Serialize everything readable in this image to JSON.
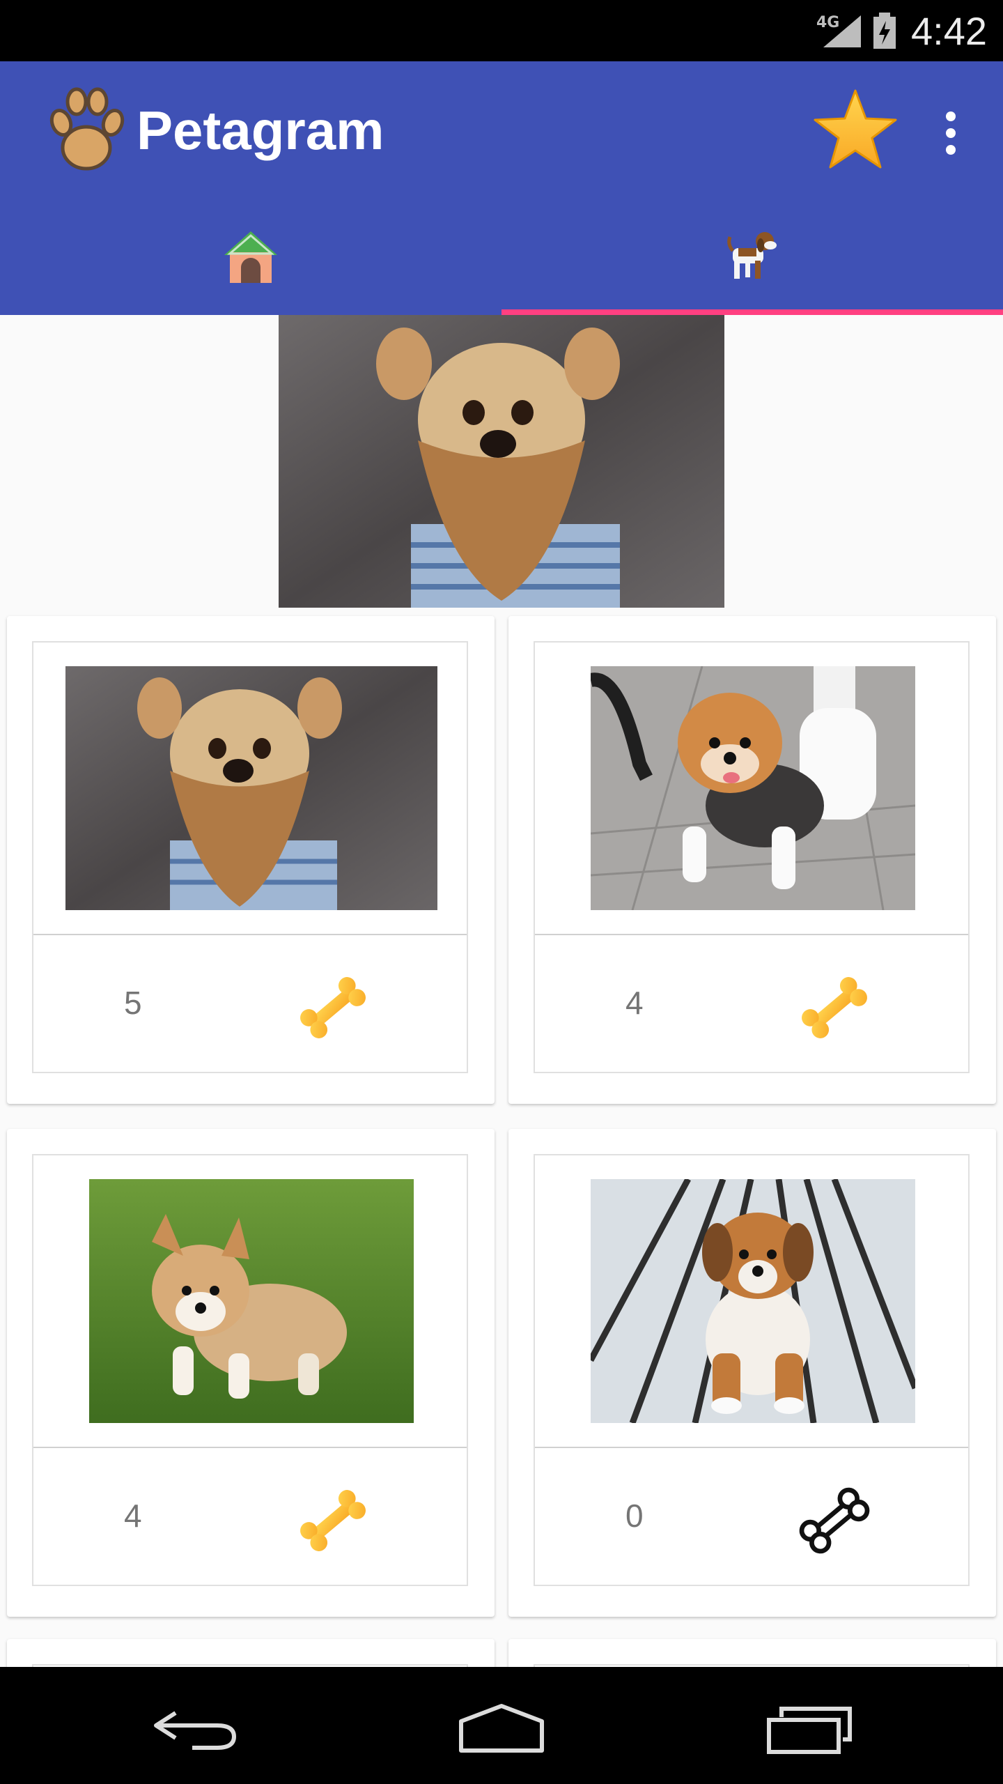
{
  "status_bar": {
    "network": "4G",
    "time": "4:42"
  },
  "app_bar": {
    "title": "Petagram",
    "tabs": [
      {
        "icon": "doghouse-icon",
        "selected": false
      },
      {
        "icon": "dog-icon",
        "selected": true
      }
    ],
    "actions": [
      "star-icon",
      "overflow-menu-icon"
    ],
    "colors": {
      "primary": "#3f51b5",
      "accent": "#ff4081"
    }
  },
  "pets": [
    {
      "likes": "5",
      "liked": true,
      "photo": "griffon-bearded-dog"
    },
    {
      "likes": "4",
      "liked": true,
      "photo": "pomeranian-in-sweater"
    },
    {
      "likes": "4",
      "liked": true,
      "photo": "corgi-puppy-on-grass"
    },
    {
      "likes": "0",
      "liked": false,
      "photo": "puppy-on-white-deck"
    }
  ],
  "nav_bar": [
    "back-icon",
    "home-icon",
    "recents-icon"
  ]
}
